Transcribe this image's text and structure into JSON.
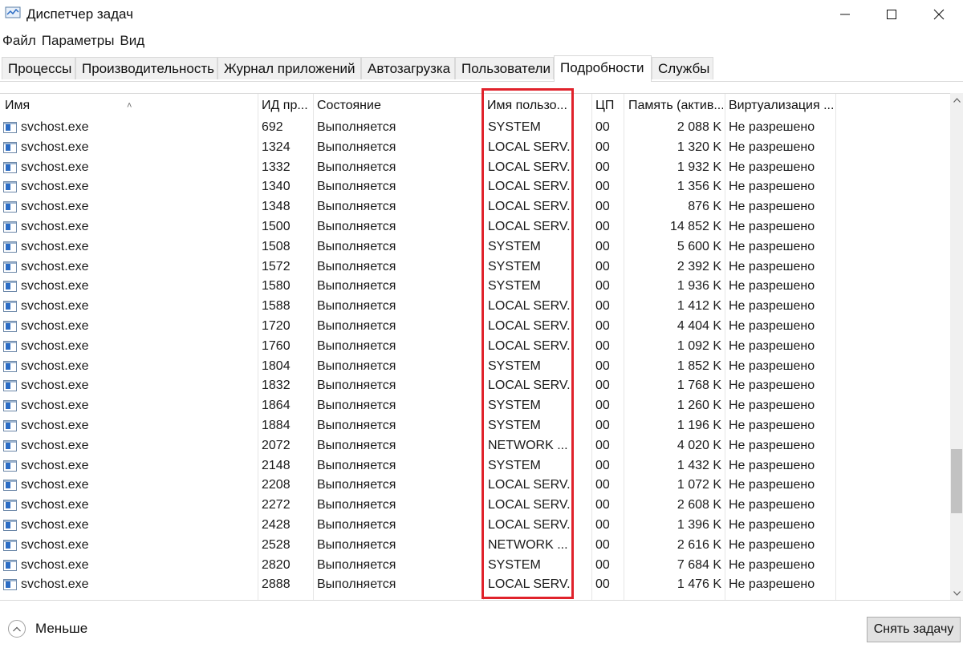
{
  "window": {
    "title": "Диспетчер задач",
    "icon": "task-manager-icon"
  },
  "menu": [
    "Файл",
    "Параметры",
    "Вид"
  ],
  "tabs": [
    {
      "label": "Процессы",
      "active": false
    },
    {
      "label": "Производительность",
      "active": false
    },
    {
      "label": "Журнал приложений",
      "active": false
    },
    {
      "label": "Автозагрузка",
      "active": false
    },
    {
      "label": "Пользователи",
      "active": false
    },
    {
      "label": "Подробности",
      "active": true
    },
    {
      "label": "Службы",
      "active": false
    }
  ],
  "table": {
    "columns": [
      "Имя",
      "ИД пр...",
      "Состояние",
      "Имя пользо...",
      "ЦП",
      "Память (актив...",
      "Виртуализация ..."
    ],
    "sorted_column": "Имя",
    "rows": [
      [
        "svchost.exe",
        "692",
        "Выполняется",
        "SYSTEM",
        "00",
        "2 088 K",
        "Не разрешено"
      ],
      [
        "svchost.exe",
        "1324",
        "Выполняется",
        "LOCAL SERV...",
        "00",
        "1 320 K",
        "Не разрешено"
      ],
      [
        "svchost.exe",
        "1332",
        "Выполняется",
        "LOCAL SERV...",
        "00",
        "1 932 K",
        "Не разрешено"
      ],
      [
        "svchost.exe",
        "1340",
        "Выполняется",
        "LOCAL SERV...",
        "00",
        "1 356 K",
        "Не разрешено"
      ],
      [
        "svchost.exe",
        "1348",
        "Выполняется",
        "LOCAL SERV...",
        "00",
        "876 K",
        "Не разрешено"
      ],
      [
        "svchost.exe",
        "1500",
        "Выполняется",
        "LOCAL SERV...",
        "00",
        "14 852 K",
        "Не разрешено"
      ],
      [
        "svchost.exe",
        "1508",
        "Выполняется",
        "SYSTEM",
        "00",
        "5 600 K",
        "Не разрешено"
      ],
      [
        "svchost.exe",
        "1572",
        "Выполняется",
        "SYSTEM",
        "00",
        "2 392 K",
        "Не разрешено"
      ],
      [
        "svchost.exe",
        "1580",
        "Выполняется",
        "SYSTEM",
        "00",
        "1 936 K",
        "Не разрешено"
      ],
      [
        "svchost.exe",
        "1588",
        "Выполняется",
        "LOCAL SERV...",
        "00",
        "1 412 K",
        "Не разрешено"
      ],
      [
        "svchost.exe",
        "1720",
        "Выполняется",
        "LOCAL SERV...",
        "00",
        "4 404 K",
        "Не разрешено"
      ],
      [
        "svchost.exe",
        "1760",
        "Выполняется",
        "LOCAL SERV...",
        "00",
        "1 092 K",
        "Не разрешено"
      ],
      [
        "svchost.exe",
        "1804",
        "Выполняется",
        "SYSTEM",
        "00",
        "1 852 K",
        "Не разрешено"
      ],
      [
        "svchost.exe",
        "1832",
        "Выполняется",
        "LOCAL SERV...",
        "00",
        "1 768 K",
        "Не разрешено"
      ],
      [
        "svchost.exe",
        "1864",
        "Выполняется",
        "SYSTEM",
        "00",
        "1 260 K",
        "Не разрешено"
      ],
      [
        "svchost.exe",
        "1884",
        "Выполняется",
        "SYSTEM",
        "00",
        "1 196 K",
        "Не разрешено"
      ],
      [
        "svchost.exe",
        "2072",
        "Выполняется",
        "NETWORK ...",
        "00",
        "4 020 K",
        "Не разрешено"
      ],
      [
        "svchost.exe",
        "2148",
        "Выполняется",
        "SYSTEM",
        "00",
        "1 432 K",
        "Не разрешено"
      ],
      [
        "svchost.exe",
        "2208",
        "Выполняется",
        "LOCAL SERV...",
        "00",
        "1 072 K",
        "Не разрешено"
      ],
      [
        "svchost.exe",
        "2272",
        "Выполняется",
        "LOCAL SERV...",
        "00",
        "2 608 K",
        "Не разрешено"
      ],
      [
        "svchost.exe",
        "2428",
        "Выполняется",
        "LOCAL SERV...",
        "00",
        "1 396 K",
        "Не разрешено"
      ],
      [
        "svchost.exe",
        "2528",
        "Выполняется",
        "NETWORK ...",
        "00",
        "2 616 K",
        "Не разрешено"
      ],
      [
        "svchost.exe",
        "2820",
        "Выполняется",
        "SYSTEM",
        "00",
        "7 684 K",
        "Не разрешено"
      ],
      [
        "svchost.exe",
        "2888",
        "Выполняется",
        "LOCAL SERV...",
        "00",
        "1 476 K",
        "Не разрешено"
      ]
    ]
  },
  "highlight": {
    "column": "Имя пользо...",
    "color": "#e0222b"
  },
  "footer": {
    "less_label": "Меньше",
    "end_task_label": "Снять задачу"
  },
  "colors": {
    "accent": "#2b6cc4",
    "highlight": "#e0222b",
    "tab_bg": "#f0f0f0"
  }
}
